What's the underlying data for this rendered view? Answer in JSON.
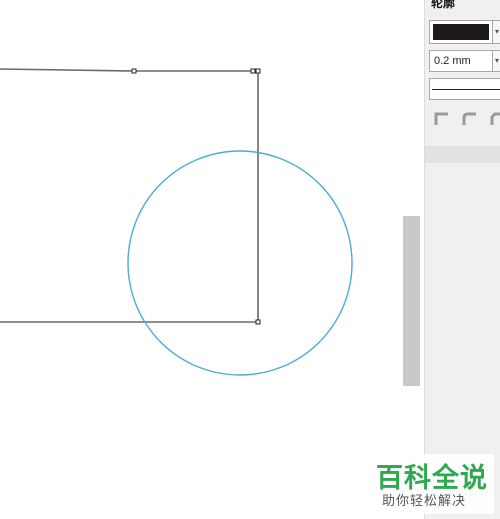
{
  "canvas": {
    "shapes": {
      "polyline_color": "#6a6a6a",
      "circle_color": "#4aaed0",
      "node_color": "#222222"
    }
  },
  "scrollbar": {
    "thumb_color": "#c9c9c9"
  },
  "outline_panel": {
    "title": "轮廓",
    "color_swatch": "#1f1a17",
    "width_value": "0.2 mm",
    "dropdown_glyph": "▾",
    "line_style": "solid",
    "corner_icons": [
      "miter-corner-icon",
      "round-corner-icon",
      "bevel-corner-icon"
    ]
  },
  "watermark": {
    "title": "百科全说",
    "subtitle": "助你轻松解决",
    "title_color": "#2fa84f"
  }
}
